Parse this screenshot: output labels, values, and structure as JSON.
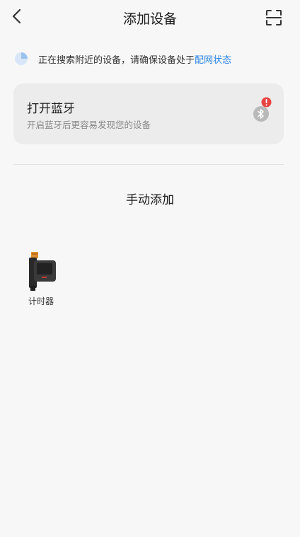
{
  "header": {
    "title": "添加设备",
    "back_icon": "chevron-left-icon",
    "scan_icon": "scan-icon"
  },
  "notice": {
    "icon": "loading-spinner-icon",
    "text": "正在搜索附近的设备，请确保设备处于",
    "link": "配网状态"
  },
  "bluetooth_card": {
    "title": "打开蓝牙",
    "subtitle": "开启蓝牙后更容易发现您的设备",
    "icon": "bluetooth-icon",
    "badge_icon": "error-badge-icon"
  },
  "manual_add": {
    "title": "手动添加",
    "devices": [
      {
        "label": "计时器",
        "icon": "timer-device-icon"
      }
    ]
  },
  "colors": {
    "background": "#f7f7f7",
    "card": "#ececec",
    "link": "#2a85e6",
    "badge": "#e84343"
  }
}
